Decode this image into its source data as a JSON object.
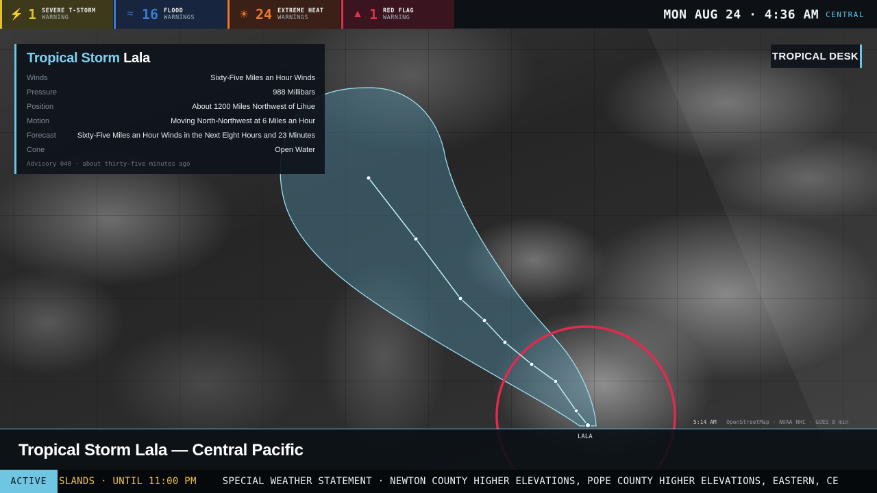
{
  "warnings": [
    {
      "count": "1",
      "line1": "SEVERE T-STORM",
      "line2": "WARNING",
      "icon": "lightning-icon",
      "glyph": "⚡",
      "color": "#e0c02c",
      "bg": "#3d3a1c"
    },
    {
      "count": "16",
      "line1": "FLOOD",
      "line2": "WARNINGS",
      "icon": "flood-waves-icon",
      "glyph": "≈",
      "color": "#3b7bd6",
      "bg": "#17263e"
    },
    {
      "count": "24",
      "line1": "EXTREME HEAT",
      "line2": "WARNINGS",
      "icon": "sun-icon",
      "glyph": "☀",
      "color": "#f07830",
      "bg": "#3a2016"
    },
    {
      "count": "1",
      "line1": "RED FLAG",
      "line2": "WARNING",
      "icon": "warning-triangle-icon",
      "glyph": "▲",
      "color": "#e0304a",
      "bg": "#3a1520"
    }
  ],
  "clock": {
    "time": "MON AUG 24 · 4:36 AM",
    "zone": "CENTRAL"
  },
  "panel": {
    "title_accent": "Tropical Storm",
    "title_name": "Lala",
    "rows": [
      {
        "k": "Winds",
        "v": "Sixty-Five Miles an Hour Winds"
      },
      {
        "k": "Pressure",
        "v": "988 Millibars"
      },
      {
        "k": "Position",
        "v": "About 1200 Miles Northwest of Lihue"
      },
      {
        "k": "Motion",
        "v": "Moving North-Northwest at 6 Miles an Hour"
      },
      {
        "k": "Forecast",
        "v": "Sixty-Five Miles an Hour Winds in the Next Eight Hours and 23 Minutes"
      },
      {
        "k": "Cone",
        "v": "Open Water"
      }
    ],
    "advisory": "Advisory 048 · about thirty-five minutes ago"
  },
  "desk": "TROPICAL DESK",
  "attribution": {
    "time": "5:14 AM",
    "sources": "OpenStreetMap · NOAA NHC · GOES 8 min"
  },
  "storm_marker_label": "LALA",
  "lower_title": "Tropical Storm Lala — Central Pacific",
  "ticker": {
    "tag": "ACTIVE",
    "highlight": "SLANDS · UNTIL 11:00 PM",
    "text": "SPECIAL WEATHER STATEMENT · NEWTON COUNTY HIGHER ELEVATIONS, POPE COUNTY HIGHER ELEVATIONS, EASTERN, CE"
  },
  "colors": {
    "accent": "#6fc6e3",
    "cone_fill": "#4f8fa6",
    "wind_ring": "#e3294e"
  }
}
